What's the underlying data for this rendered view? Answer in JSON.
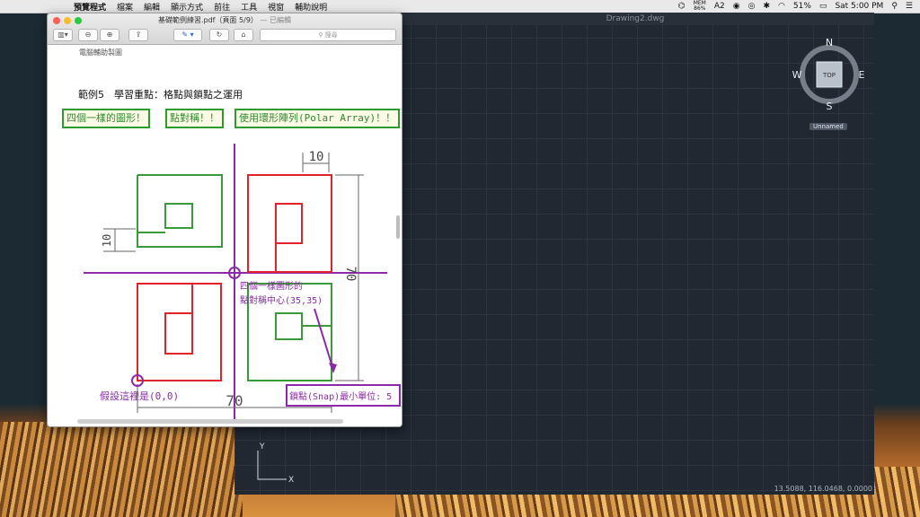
{
  "menubar": {
    "items": [
      "預覽程式",
      "檔案",
      "編輯",
      "顯示方式",
      "前往",
      "工具",
      "視窗",
      "輔助說明"
    ],
    "status": {
      "mem_label": "MEM",
      "mem_value": "86%",
      "adobe": "2",
      "battery": "51%",
      "clock": "Sat 5:00 PM"
    }
  },
  "preview": {
    "title": "基礎範例練習.pdf（頁面 5/9）",
    "edited": "— 已編輯",
    "search_placeholder": "搜尋",
    "page": {
      "header": "電腦輔助製圖",
      "lesson": "範例5　學習重點：格點與鎖點之運用",
      "tags": [
        "四個一樣的圖形！",
        "點對稱！！",
        "使用環形陣列(Polar Array)！！"
      ],
      "dim_top": "10",
      "dim_left": "10",
      "dim_right": "70",
      "dim_bottom": "70",
      "note_symmetry_line1": "四個一樣圖形的",
      "note_symmetry_line2": "點對稱中心(35,35)",
      "note_origin": "假設這裡是(0,0)",
      "note_snap": "鎖點(Snap)最小單位: 5"
    }
  },
  "cad": {
    "title": "Drawing2.dwg",
    "compass": {
      "n": "N",
      "s": "S",
      "e": "E",
      "w": "W",
      "top": "TOP"
    },
    "ucs_label": "Unnamed",
    "axis_x": "X",
    "axis_y": "Y",
    "coords": "13.5088, 116.0468, 0.0000"
  },
  "colors": {
    "green": "#3a9a3a",
    "red": "#e2222a",
    "purple": "#8a2aa8",
    "grid_bg": "#212832"
  }
}
